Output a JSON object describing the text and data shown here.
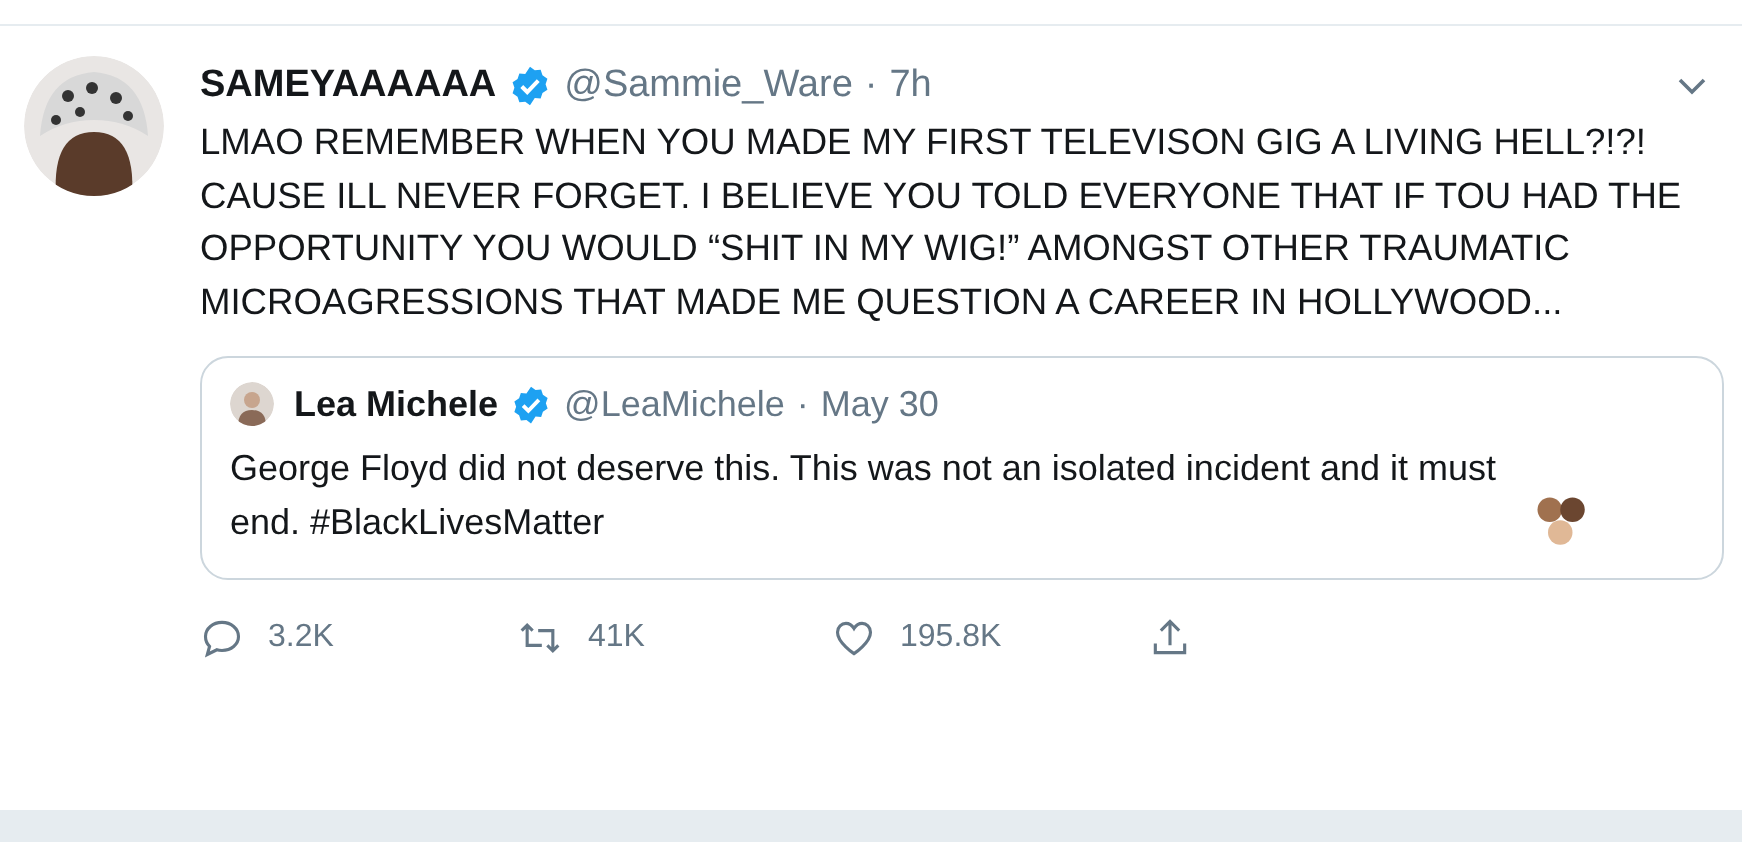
{
  "tweet": {
    "display_name": "SAMEYAAAAAA",
    "verified": true,
    "handle": "@Sammie_Ware",
    "separator": "·",
    "time": "7h",
    "text": "LMAO REMEMBER WHEN YOU MADE MY FIRST TELEVISON GIG A LIVING HELL?!?! CAUSE ILL NEVER FORGET. I BELIEVE YOU TOLD EVERYONE THAT IF TOU HAD THE OPPORTUNITY YOU WOULD “SHIT IN MY WIG!” AMONGST OTHER TRAUMATIC MICROAGRESSIONS THAT MADE ME QUESTION A CAREER IN HOLLYWOOD...",
    "quoted": {
      "display_name": "Lea Michele",
      "verified": true,
      "handle": "@LeaMichele",
      "separator": "·",
      "time": "May 30",
      "text": "George Floyd did not deserve this. This was not an isolated incident and it must end. #BlackLivesMatter"
    },
    "actions": [
      {
        "kind": "reply",
        "count": "3.2K"
      },
      {
        "kind": "retweet",
        "count": "41K"
      },
      {
        "kind": "like",
        "count": "195.8K"
      },
      {
        "kind": "share"
      }
    ]
  }
}
